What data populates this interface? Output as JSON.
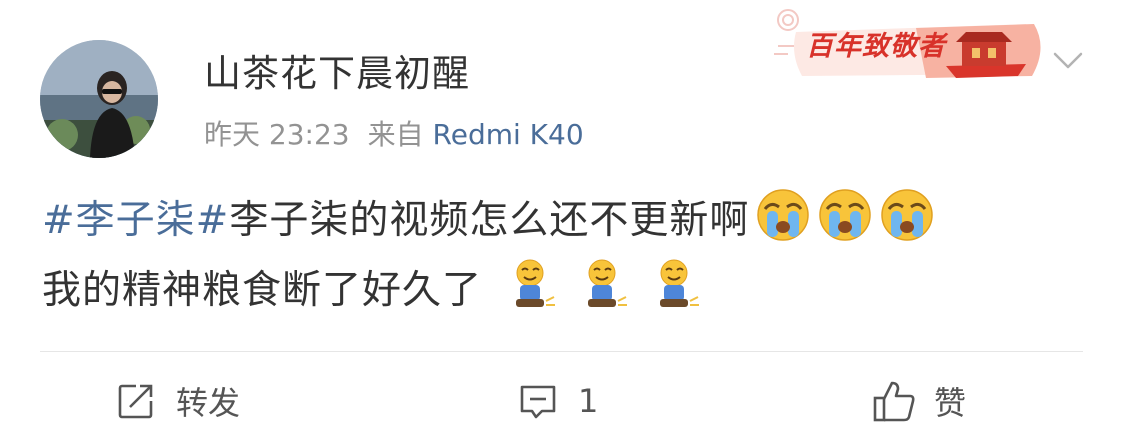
{
  "post": {
    "username": "山茶花下晨初醒",
    "time": "昨天 23:23",
    "source_prefix": "来自",
    "device": "Redmi K40",
    "badge_text": "百年致敬者",
    "content": {
      "topic": "#李子柒#",
      "line1_text": "李子柒的视频怎么还不更新啊",
      "line2_text": "我的精神粮食断了好久了",
      "line1_emojis": [
        "crying-face",
        "crying-face",
        "crying-face"
      ],
      "line2_emojis": [
        "sitting-smile",
        "sitting-smile",
        "sitting-smile"
      ]
    }
  },
  "actions": {
    "repost_label": "转发",
    "comment_count": "1",
    "like_label": "赞"
  },
  "colors": {
    "link_blue": "#4a6d99",
    "meta_gray": "#939393",
    "badge_red": "#d8322a"
  }
}
